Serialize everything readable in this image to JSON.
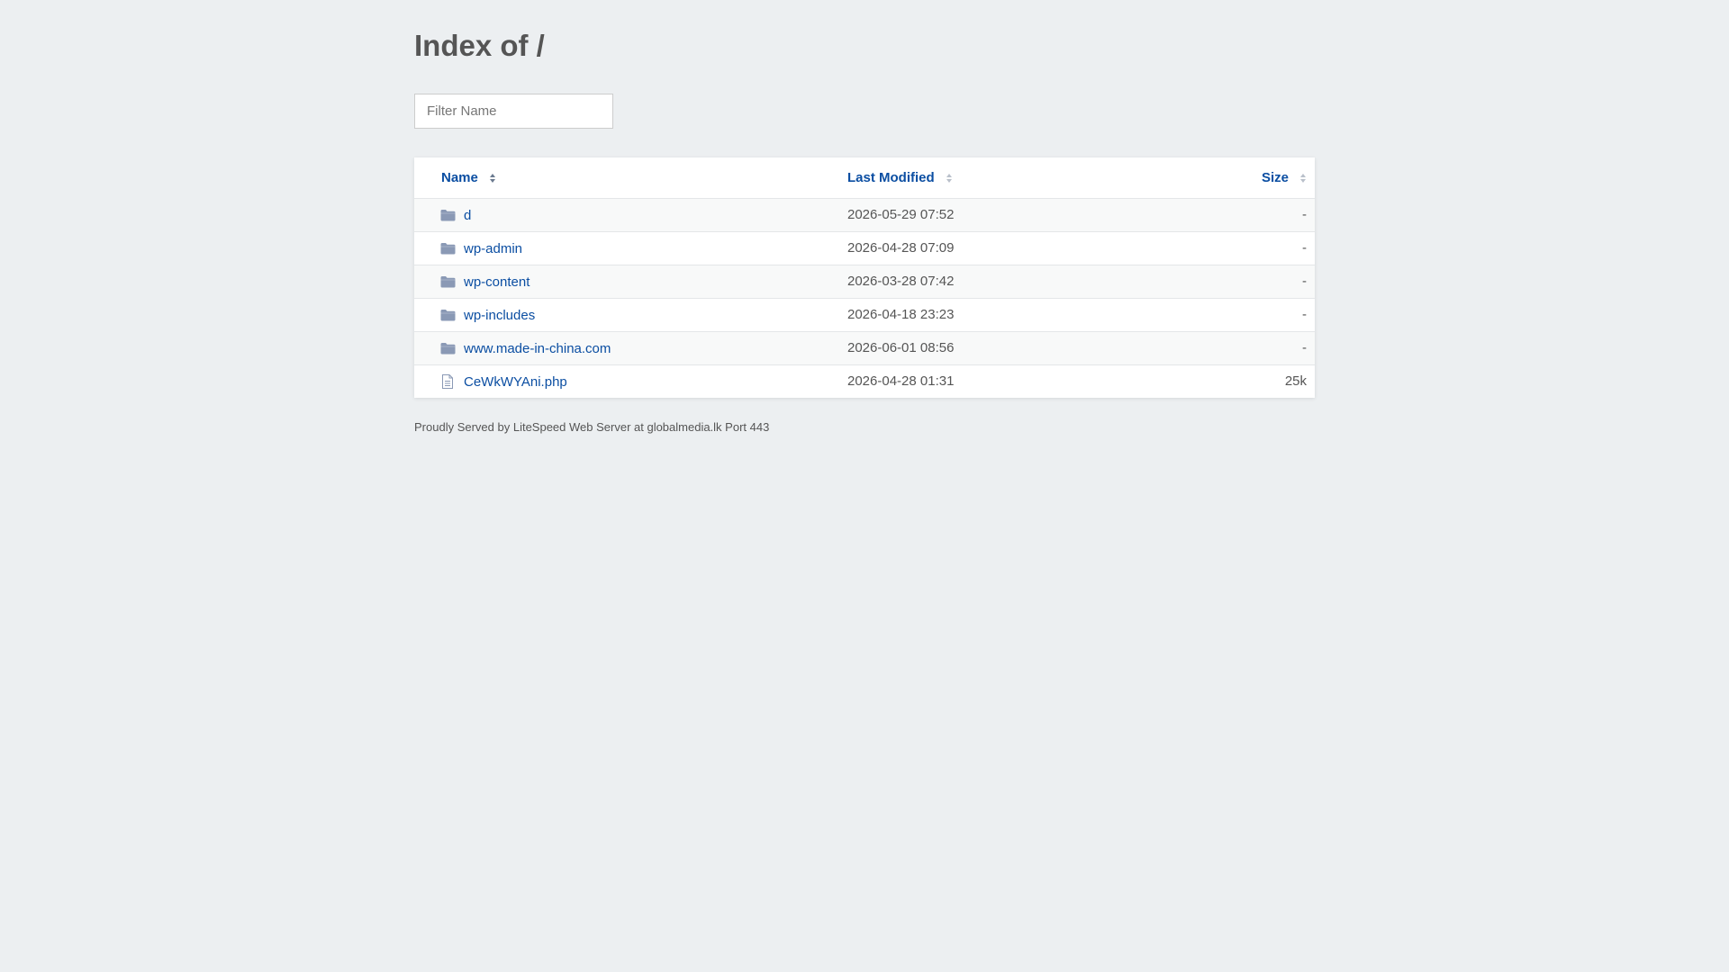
{
  "page": {
    "title": "Index of /"
  },
  "filter": {
    "placeholder": "Filter Name",
    "value": ""
  },
  "table": {
    "columns": {
      "name": "Name",
      "modified": "Last Modified",
      "size": "Size"
    },
    "rows": [
      {
        "name": "d",
        "modified": "2026-05-29 07:52",
        "size": "-",
        "icon": "folder-icon"
      },
      {
        "name": "wp-admin",
        "modified": "2026-04-28 07:09",
        "size": "-",
        "icon": "folder-icon"
      },
      {
        "name": "wp-content",
        "modified": "2026-03-28 07:42",
        "size": "-",
        "icon": "folder-icon"
      },
      {
        "name": "wp-includes",
        "modified": "2026-04-18 23:23",
        "size": "-",
        "icon": "folder-icon"
      },
      {
        "name": "www.made-in-china.com",
        "modified": "2026-06-01 08:56",
        "size": "-",
        "icon": "folder-icon"
      },
      {
        "name": "CeWkWYAni.php",
        "modified": "2026-04-28 01:31",
        "size": "25k",
        "icon": "file-icon"
      }
    ]
  },
  "footer": {
    "text": "Proudly Served by LiteSpeed Web Server at globalmedia.lk Port 443"
  },
  "colors": {
    "background": "#eceff1",
    "link": "#0b4ea2",
    "folder_icon": "#8a99b5"
  }
}
